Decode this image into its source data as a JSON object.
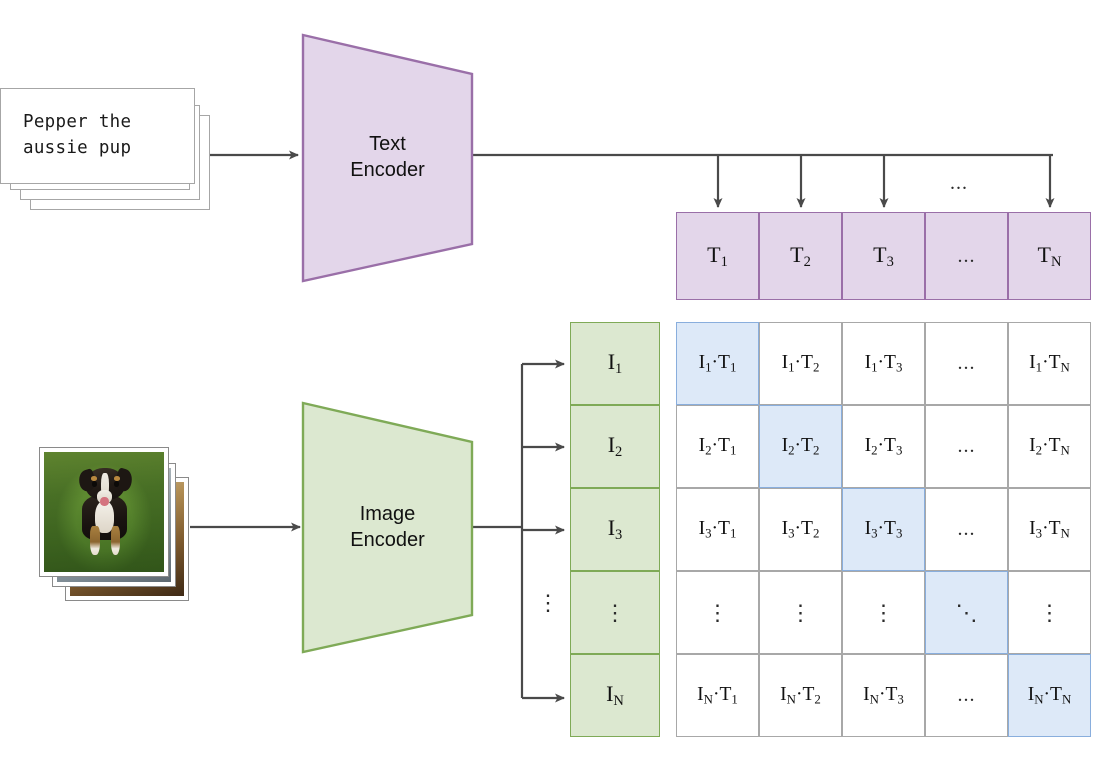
{
  "figure": {
    "title": "CLIP contrastive pre-training diagram",
    "background_color": "#ffffff"
  },
  "text_input": {
    "name": "text-card-stack",
    "caption": "Pepper the\naussie pup",
    "card_count": 4,
    "card_fill": "#ffffff",
    "card_border": "#a6a6a6"
  },
  "image_input": {
    "name": "photo-stack",
    "photo_count": 3,
    "front_photo_description": "puppy on grass"
  },
  "encoders": {
    "text": {
      "label": "Text\nEncoder",
      "fill": "#e3d6ea",
      "stroke": "#9a6fa8"
    },
    "image": {
      "label": "Image\nEncoder",
      "fill": "#dce8d0",
      "stroke": "#7faa57"
    }
  },
  "text_embeddings": {
    "name": "text-embedding-row",
    "fill": "#e3d6ea",
    "stroke": "#9a6fa8",
    "cells": [
      {
        "base": "T",
        "sub": "1",
        "is_ellipsis": false
      },
      {
        "base": "T",
        "sub": "2",
        "is_ellipsis": false
      },
      {
        "base": "T",
        "sub": "3",
        "is_ellipsis": false
      },
      {
        "base": "...",
        "sub": "",
        "is_ellipsis": true
      },
      {
        "base": "T",
        "sub": "N",
        "is_ellipsis": false
      }
    ],
    "top_ellipsis": "..."
  },
  "image_embeddings": {
    "name": "image-embedding-column",
    "fill": "#dce8d0",
    "stroke": "#7faa57",
    "cells": [
      {
        "base": "I",
        "sub": "1",
        "is_ellipsis": false
      },
      {
        "base": "I",
        "sub": "2",
        "is_ellipsis": false
      },
      {
        "base": "I",
        "sub": "3",
        "is_ellipsis": false
      },
      {
        "base": "⋮",
        "sub": "",
        "is_ellipsis": true
      },
      {
        "base": "I",
        "sub": "N",
        "is_ellipsis": false
      }
    ],
    "bus_ellipsis": "⋮"
  },
  "similarity_matrix": {
    "name": "similarity-matrix",
    "cell_fill": "#ffffff",
    "cell_border": "#a8a8a8",
    "diagonal_fill": "#dde9f8",
    "diagonal_border": "#89aedd",
    "row_labels": [
      "I1",
      "I2",
      "I3",
      "vdots",
      "IN"
    ],
    "col_labels": [
      "T1",
      "T2",
      "T3",
      "dots",
      "TN"
    ],
    "rows": [
      [
        {
          "text": "I₁·T₁",
          "i": "1",
          "j": "1",
          "kind": "dot",
          "diag": true
        },
        {
          "text": "I₁·T₂",
          "i": "1",
          "j": "2",
          "kind": "dot",
          "diag": false
        },
        {
          "text": "I₁·T₃",
          "i": "1",
          "j": "3",
          "kind": "dot",
          "diag": false
        },
        {
          "text": "...",
          "i": "1",
          "j": "",
          "kind": "hdots",
          "diag": false
        },
        {
          "text": "I₁·Tₙ",
          "i": "1",
          "j": "N",
          "kind": "dot",
          "diag": false
        }
      ],
      [
        {
          "text": "I₂·T₁",
          "i": "2",
          "j": "1",
          "kind": "dot",
          "diag": false
        },
        {
          "text": "I₂·T₂",
          "i": "2",
          "j": "2",
          "kind": "dot",
          "diag": true
        },
        {
          "text": "I₂·T₃",
          "i": "2",
          "j": "3",
          "kind": "dot",
          "diag": false
        },
        {
          "text": "...",
          "i": "2",
          "j": "",
          "kind": "hdots",
          "diag": false
        },
        {
          "text": "I₂·Tₙ",
          "i": "2",
          "j": "N",
          "kind": "dot",
          "diag": false
        }
      ],
      [
        {
          "text": "I₃·T₁",
          "i": "3",
          "j": "1",
          "kind": "dot",
          "diag": false
        },
        {
          "text": "I₃·T₂",
          "i": "3",
          "j": "2",
          "kind": "dot",
          "diag": false
        },
        {
          "text": "I₃·T₃",
          "i": "3",
          "j": "3",
          "kind": "dot",
          "diag": true
        },
        {
          "text": "...",
          "i": "3",
          "j": "",
          "kind": "hdots",
          "diag": false
        },
        {
          "text": "I₃·Tₙ",
          "i": "3",
          "j": "N",
          "kind": "dot",
          "diag": false
        }
      ],
      [
        {
          "text": "⋮",
          "i": "",
          "j": "1",
          "kind": "vdots",
          "diag": false
        },
        {
          "text": "⋮",
          "i": "",
          "j": "2",
          "kind": "vdots",
          "diag": false
        },
        {
          "text": "⋮",
          "i": "",
          "j": "3",
          "kind": "vdots",
          "diag": false
        },
        {
          "text": "⋱",
          "i": "",
          "j": "",
          "kind": "ddots",
          "diag": true
        },
        {
          "text": "⋮",
          "i": "",
          "j": "N",
          "kind": "vdots",
          "diag": false
        }
      ],
      [
        {
          "text": "Iₙ·T₁",
          "i": "N",
          "j": "1",
          "kind": "dot",
          "diag": false
        },
        {
          "text": "Iₙ·T₂",
          "i": "N",
          "j": "2",
          "kind": "dot",
          "diag": false
        },
        {
          "text": "Iₙ·T₃",
          "i": "N",
          "j": "3",
          "kind": "dot",
          "diag": false
        },
        {
          "text": "...",
          "i": "N",
          "j": "",
          "kind": "hdots",
          "diag": false
        },
        {
          "text": "Iₙ·Tₙ",
          "i": "N",
          "j": "N",
          "kind": "dot",
          "diag": true
        }
      ]
    ]
  },
  "connector_color": "#4a4a4a"
}
